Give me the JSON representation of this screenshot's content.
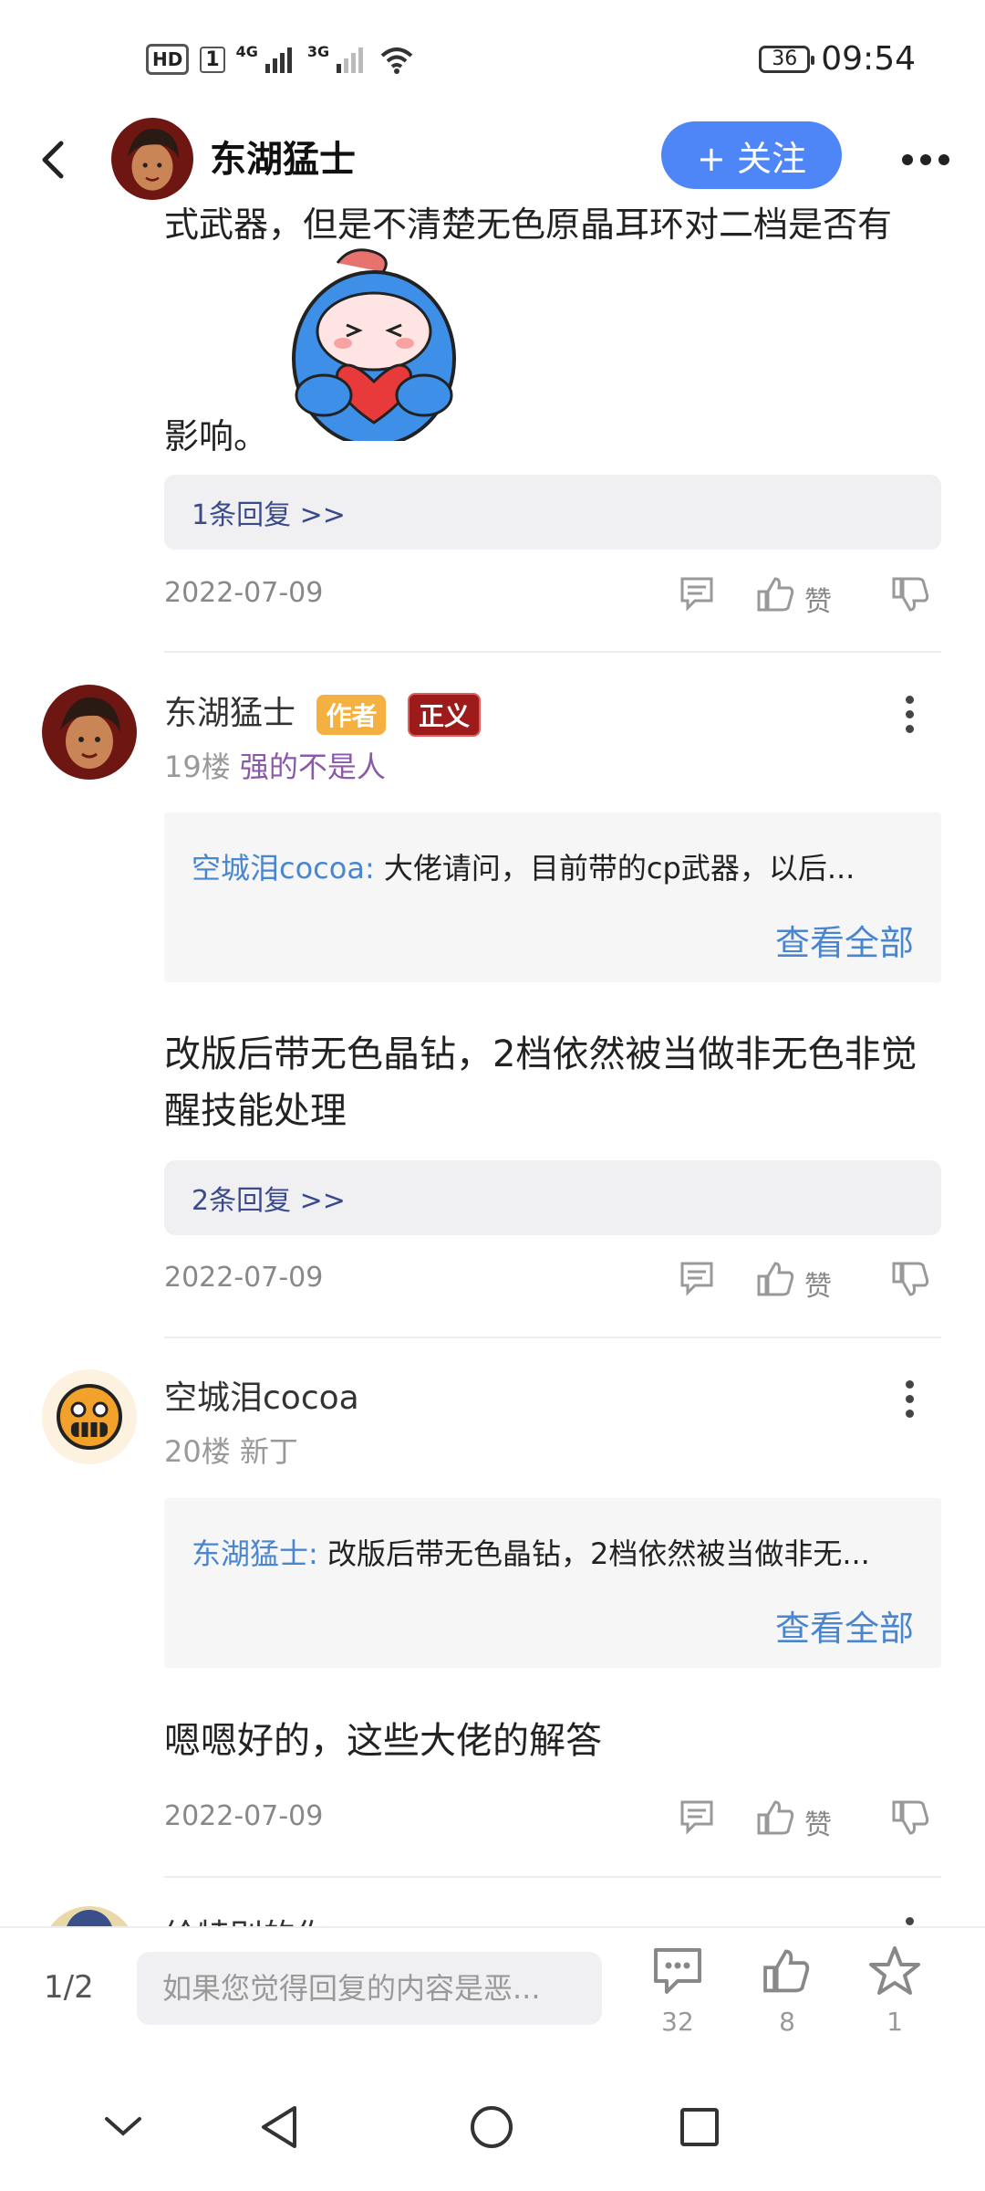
{
  "status_bar": {
    "hd": "HD",
    "sim": "1",
    "net1": "4G",
    "net2": "3G",
    "battery": "36",
    "time": "09:54"
  },
  "top_bar": {
    "title": "东湖猛士",
    "follow_label": "+ 关注"
  },
  "prev_post": {
    "partial_text": "式武器，但是不清楚无色原晶耳环对二档是否有",
    "ending_text": "影响。",
    "replies_label": "1条回复 >>",
    "date": "2022-07-09",
    "like_label": "赞"
  },
  "post_19": {
    "author": "东湖猛士",
    "badge_author": "作者",
    "badge_justice": "正义",
    "floor": "19楼",
    "tail": "强的不是人",
    "quote_author": "空城泪cocoa:",
    "quote_text": " 大佬请问，目前带的cp武器，以后...",
    "quote_more": "查看全部",
    "text": "改版后带无色晶钻，2档依然被当做非无色非觉醒技能处理",
    "replies_label": "2条回复 >>",
    "date": "2022-07-09",
    "like_label": "赞"
  },
  "post_20": {
    "author": "空城泪cocoa",
    "floor": "20楼",
    "tail": "新丁",
    "quote_author": "东湖猛士:",
    "quote_text": " 改版后带无色晶钻，2档依然被当做非无...",
    "quote_more": "查看全部",
    "text": "嗯嗯好的，这些大佬的解答",
    "date": "2022-07-09",
    "like_label": "赞"
  },
  "next_post": {
    "author_partial": "给特别的你"
  },
  "bottom_bar": {
    "page": "1/2",
    "input_placeholder": "如果您觉得回复的内容是恶...",
    "comment_count": "32",
    "like_count": "8",
    "fav_count": "1"
  },
  "colors": {
    "accent": "#4f86f7",
    "link": "#4a86d0",
    "reply_text": "#3a4a8a",
    "tail_purple": "#8a5aa8",
    "badge_author": "#f5b042",
    "badge_justice": "#9e1b1b"
  }
}
